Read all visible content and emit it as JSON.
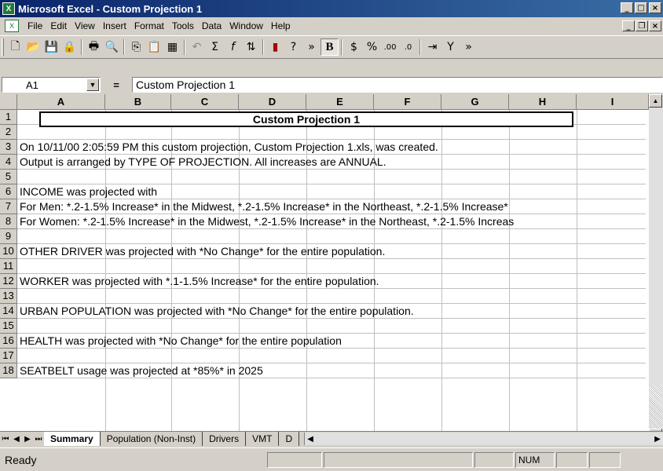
{
  "window": {
    "title": "Microsoft Excel - Custom Projection 1"
  },
  "menu": [
    "File",
    "Edit",
    "View",
    "Insert",
    "Format",
    "Tools",
    "Data",
    "Window",
    "Help"
  ],
  "toolbar_icons": [
    "new-icon",
    "open-icon",
    "save-icon",
    "permission-icon",
    "print-icon",
    "print-preview-icon",
    "copy-icon",
    "paste-icon",
    "paste-special-icon",
    "undo-icon",
    "autosum-icon",
    "function-icon",
    "sort-icon",
    "chart-icon",
    "help-icon",
    "bold-icon",
    "currency-icon",
    "percent-icon",
    "increase-decimal-icon",
    "decrease-decimal-icon",
    "indent-icon",
    "filter-icon"
  ],
  "formula": {
    "name_box": "A1",
    "equals": "=",
    "content": "Custom Projection 1"
  },
  "columns": [
    "A",
    "B",
    "C",
    "D",
    "E",
    "F",
    "G",
    "H",
    "I"
  ],
  "rows": [
    {
      "n": "1",
      "text": "Custom Projection 1"
    },
    {
      "n": "2",
      "text": ""
    },
    {
      "n": "3",
      "text": "On 10/11/00 2:05:59 PM this custom projection, Custom Projection 1.xls, was created."
    },
    {
      "n": "4",
      "text": "Output is arranged by TYPE OF PROJECTION.  All increases are ANNUAL."
    },
    {
      "n": "5",
      "text": ""
    },
    {
      "n": "6",
      "text": "INCOME was projected with"
    },
    {
      "n": "7",
      "text": "For Men: *.2-1.5% Increase* in the Midwest, *.2-1.5% Increase* in the Northeast, *.2-1.5% Increase*"
    },
    {
      "n": "8",
      "text": "For Women: *.2-1.5% Increase* in the Midwest, *.2-1.5% Increase* in the Northeast, *.2-1.5% Increas"
    },
    {
      "n": "9",
      "text": ""
    },
    {
      "n": "10",
      "text": "OTHER DRIVER was projected with *No Change* for the entire population."
    },
    {
      "n": "11",
      "text": ""
    },
    {
      "n": "12",
      "text": "WORKER was projected with *.1-1.5% Increase* for the entire population."
    },
    {
      "n": "13",
      "text": ""
    },
    {
      "n": "14",
      "text": "URBAN POPULATION was projected with *No Change* for the entire population."
    },
    {
      "n": "15",
      "text": ""
    },
    {
      "n": "16",
      "text": "HEALTH was projected with *No Change* for the entire population"
    },
    {
      "n": "17",
      "text": ""
    },
    {
      "n": "18",
      "text": "SEATBELT usage was projected at *85%* in 2025"
    }
  ],
  "tabs": [
    "Summary",
    "Population (Non-Inst)",
    "Drivers",
    "VMT",
    "D"
  ],
  "status": {
    "text": "Ready",
    "num": "NUM"
  }
}
